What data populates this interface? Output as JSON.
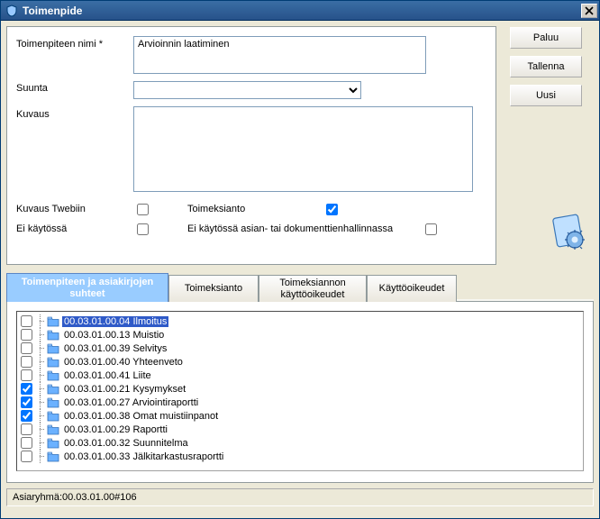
{
  "window": {
    "title": "Toimenpide"
  },
  "form": {
    "nimi_label": "Toimenpiteen nimi *",
    "nimi_value": "Arvioinnin laatiminen",
    "suunta_label": "Suunta",
    "suunta_value": "",
    "kuvaus_label": "Kuvaus",
    "kuvaus_value": "",
    "kuvaus_twebiin_label": "Kuvaus Twebiin",
    "kuvaus_twebiin_checked": false,
    "toimeksianto_label": "Toimeksianto",
    "toimeksianto_checked": true,
    "ei_kaytossa_label": "Ei käytössä",
    "ei_kaytossa_checked": false,
    "ei_kaytossa_asian_label": "Ei käytössä asian- tai dokumenttienhallinnassa",
    "ei_kaytossa_asian_checked": false
  },
  "buttons": {
    "paluu": "Paluu",
    "tallenna": "Tallenna",
    "uusi": "Uusi"
  },
  "tabs": {
    "0": {
      "label": "Toimenpiteen ja asiakirjojen\nsuhteet"
    },
    "1": {
      "label": "Toimeksianto"
    },
    "2": {
      "label": "Toimeksiannon\nkäyttöoikeudet"
    },
    "3": {
      "label": "Käyttöoikeudet"
    }
  },
  "list": {
    "0": {
      "checked": false,
      "label": "00.03.01.00.04 Ilmoitus",
      "selected": true
    },
    "1": {
      "checked": false,
      "label": "00.03.01.00.13 Muistio",
      "selected": false
    },
    "2": {
      "checked": false,
      "label": "00.03.01.00.39 Selvitys",
      "selected": false
    },
    "3": {
      "checked": false,
      "label": "00.03.01.00.40 Yhteenveto",
      "selected": false
    },
    "4": {
      "checked": false,
      "label": "00.03.01.00.41 Liite",
      "selected": false
    },
    "5": {
      "checked": true,
      "label": "00.03.01.00.21 Kysymykset",
      "selected": false
    },
    "6": {
      "checked": true,
      "label": "00.03.01.00.27 Arviointiraportti",
      "selected": false
    },
    "7": {
      "checked": true,
      "label": "00.03.01.00.38 Omat muistiinpanot",
      "selected": false
    },
    "8": {
      "checked": false,
      "label": "00.03.01.00.29 Raportti",
      "selected": false
    },
    "9": {
      "checked": false,
      "label": "00.03.01.00.32 Suunnitelma",
      "selected": false
    },
    "10": {
      "checked": false,
      "label": "00.03.01.00.33 Jälkitarkastusraportti",
      "selected": false
    }
  },
  "status": "Asiaryhmä:00.03.01.00#106"
}
